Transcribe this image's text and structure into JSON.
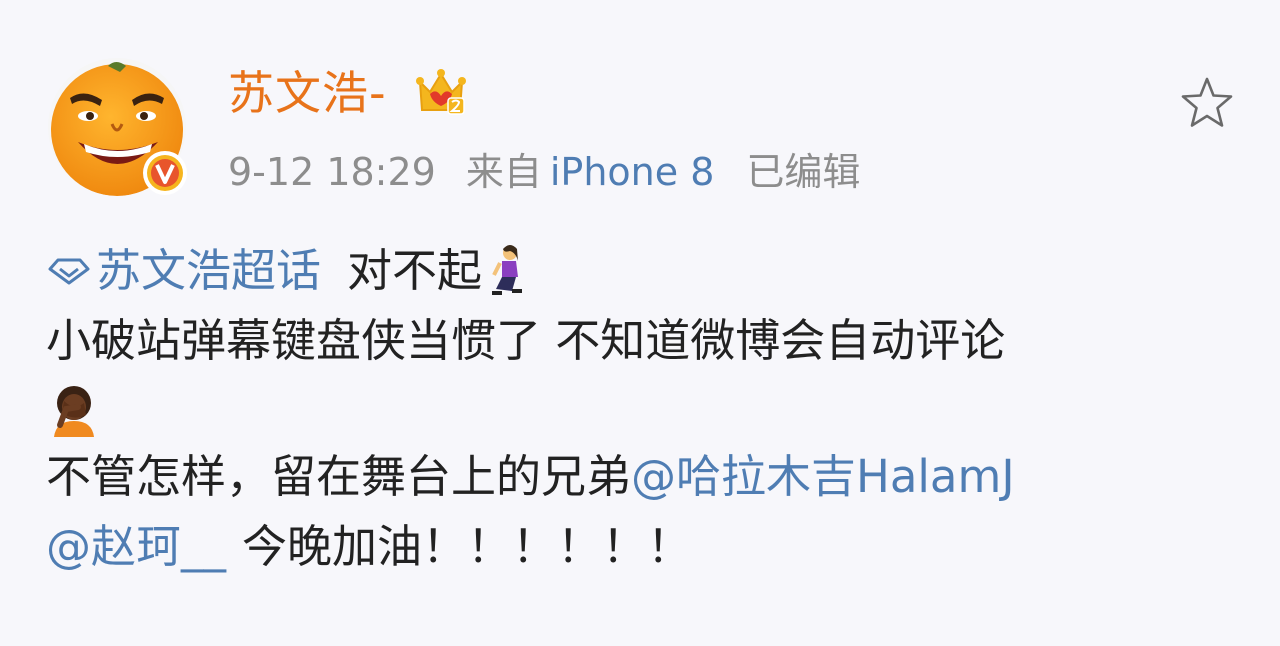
{
  "post": {
    "username": "苏文浩-",
    "time": "9-12 18:29",
    "from_label": "来自",
    "device": "iPhone 8",
    "edited": "已编辑"
  },
  "content": {
    "topic": "苏文浩超话",
    "line1_text": "对不起",
    "line2_text": "小破站弹幕键盘侠当惯了 不知道微博会自动评论",
    "line4_text": "不管怎样，留在舞台上的兄弟",
    "mention1": "@哈拉木吉HalamJ",
    "mention2": "@赵珂__",
    "line5_text": "今晚加油！！！！！！"
  },
  "icons": {
    "topic": "diamond-topic-icon",
    "crown": "crown-badge-icon",
    "verified": "verified-v-icon",
    "favorite": "star-icon",
    "emoji1": "kneeling-person-emoji",
    "emoji2": "facepalm-emoji"
  },
  "colors": {
    "username": "#e8731a",
    "link": "#4f7db3",
    "meta": "#8d8d8d",
    "text": "#222222",
    "background": "#f7f7fb"
  }
}
